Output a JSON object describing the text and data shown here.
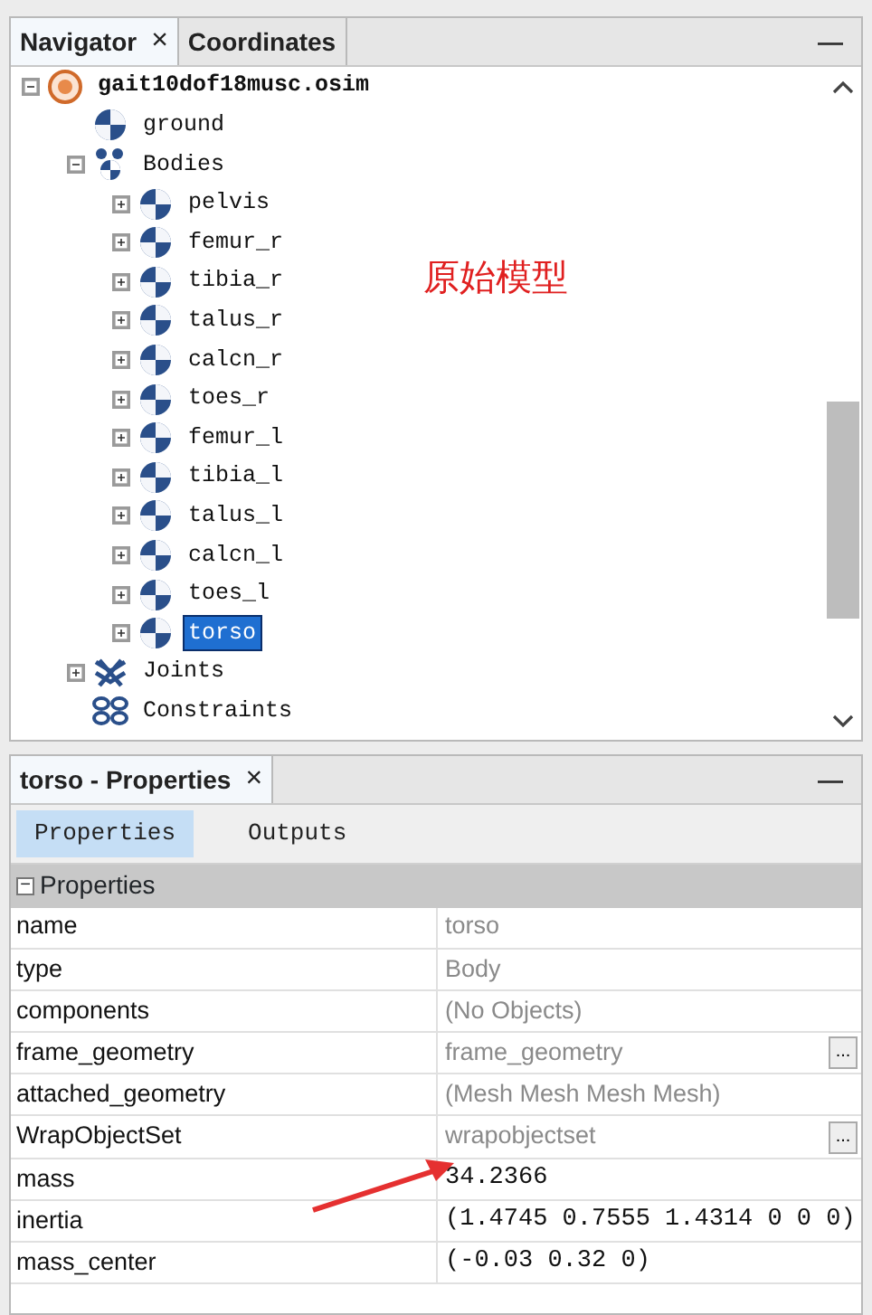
{
  "navigator_panel": {
    "tabs": [
      {
        "label": "Navigator",
        "close": "×",
        "selected": true
      },
      {
        "label": "Coordinates",
        "selected": false
      }
    ],
    "minimize": "—",
    "tree": [
      {
        "label": "gait10dof18musc.osim",
        "kind": "model",
        "expanded": true,
        "selected": false,
        "children": [
          {
            "label": "ground",
            "kind": "body",
            "selected": false
          },
          {
            "label": "Bodies",
            "kind": "bodies",
            "expanded": true,
            "selected": false,
            "children": [
              {
                "label": "pelvis",
                "kind": "body",
                "expanded": false,
                "selected": false
              },
              {
                "label": "femur_r",
                "kind": "body",
                "expanded": false,
                "selected": false
              },
              {
                "label": "tibia_r",
                "kind": "body",
                "expanded": false,
                "selected": false
              },
              {
                "label": "talus_r",
                "kind": "body",
                "expanded": false,
                "selected": false
              },
              {
                "label": "calcn_r",
                "kind": "body",
                "expanded": false,
                "selected": false
              },
              {
                "label": "toes_r",
                "kind": "body",
                "expanded": false,
                "selected": false
              },
              {
                "label": "femur_l",
                "kind": "body",
                "expanded": false,
                "selected": false
              },
              {
                "label": "tibia_l",
                "kind": "body",
                "expanded": false,
                "selected": false
              },
              {
                "label": "talus_l",
                "kind": "body",
                "expanded": false,
                "selected": false
              },
              {
                "label": "calcn_l",
                "kind": "body",
                "expanded": false,
                "selected": false
              },
              {
                "label": "toes_l",
                "kind": "body",
                "expanded": false,
                "selected": false
              },
              {
                "label": "torso",
                "kind": "body",
                "expanded": false,
                "selected": true
              }
            ]
          },
          {
            "label": "Joints",
            "kind": "joints",
            "expanded": false,
            "selected": false
          },
          {
            "label": "Constraints",
            "kind": "constraints",
            "selected": false
          }
        ]
      }
    ],
    "annotation": "原始模型"
  },
  "properties_panel": {
    "tabs": [
      {
        "label": "torso - Properties",
        "close": "×",
        "selected": true
      }
    ],
    "minimize": "—",
    "subtabs": [
      {
        "label": "Properties",
        "selected": true
      },
      {
        "label": "Outputs",
        "selected": false
      }
    ],
    "group": {
      "label": "Properties",
      "expanded": true,
      "toggle": "−"
    },
    "rows": [
      {
        "name": "name",
        "value": "torso",
        "editable": false
      },
      {
        "name": "type",
        "value": "Body",
        "editable": false
      },
      {
        "name": "components",
        "value": "(No Objects)",
        "editable": false
      },
      {
        "name": "frame_geometry",
        "value": "frame_geometry",
        "editable": false,
        "browse": "..."
      },
      {
        "name": "attached_geometry",
        "value": "(Mesh Mesh Mesh Mesh)",
        "editable": false
      },
      {
        "name": "WrapObjectSet",
        "value": "wrapobjectset",
        "editable": false,
        "browse": "..."
      },
      {
        "name": "mass",
        "value": "34.2366",
        "editable": true
      },
      {
        "name": "inertia",
        "value": "(1.4745 0.7555 1.4314 0 0 0)",
        "editable": true
      },
      {
        "name": "mass_center",
        "value": "(-0.03 0.32 0)",
        "editable": true
      }
    ]
  }
}
